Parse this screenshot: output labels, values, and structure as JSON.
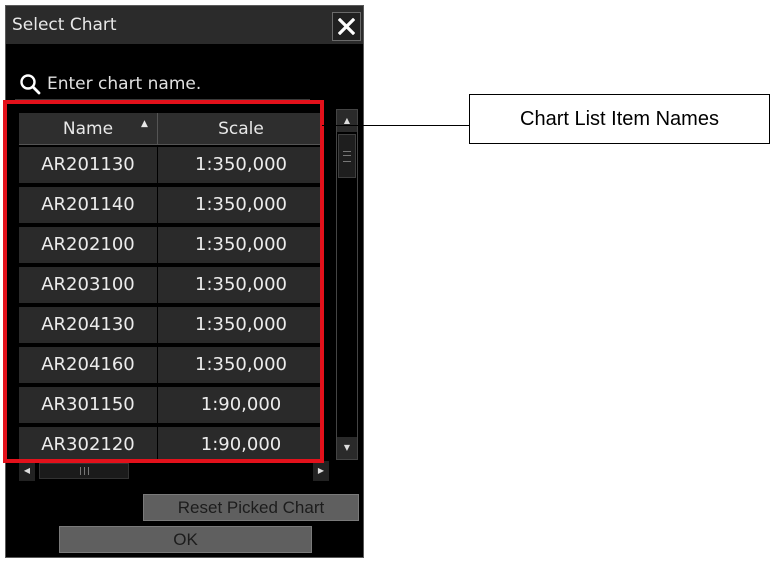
{
  "dialog": {
    "title": "Select Chart",
    "close_icon": "close-icon"
  },
  "search": {
    "placeholder": "Enter chart name.",
    "icon": "search-icon"
  },
  "table": {
    "columns": [
      {
        "label": "Name",
        "sort": "ascending"
      },
      {
        "label": "Scale"
      }
    ],
    "rows": [
      {
        "name": "AR201130",
        "scale": "1:350,000"
      },
      {
        "name": "AR201140",
        "scale": "1:350,000"
      },
      {
        "name": "AR202100",
        "scale": "1:350,000"
      },
      {
        "name": "AR203100",
        "scale": "1:350,000"
      },
      {
        "name": "AR204130",
        "scale": "1:350,000"
      },
      {
        "name": "AR204160",
        "scale": "1:350,000"
      },
      {
        "name": "AR301150",
        "scale": "1:90,000"
      },
      {
        "name": "AR302120",
        "scale": "1:90,000"
      }
    ]
  },
  "buttons": {
    "reset_label": "Reset Picked Chart",
    "ok_label": "OK"
  },
  "annotation": {
    "callout_text": "Chart List Item Names",
    "highlight_color": "#e3111b"
  },
  "colors": {
    "background": "#000000",
    "row_background": "#2a2a2a",
    "button_background": "#5f5f5f"
  }
}
